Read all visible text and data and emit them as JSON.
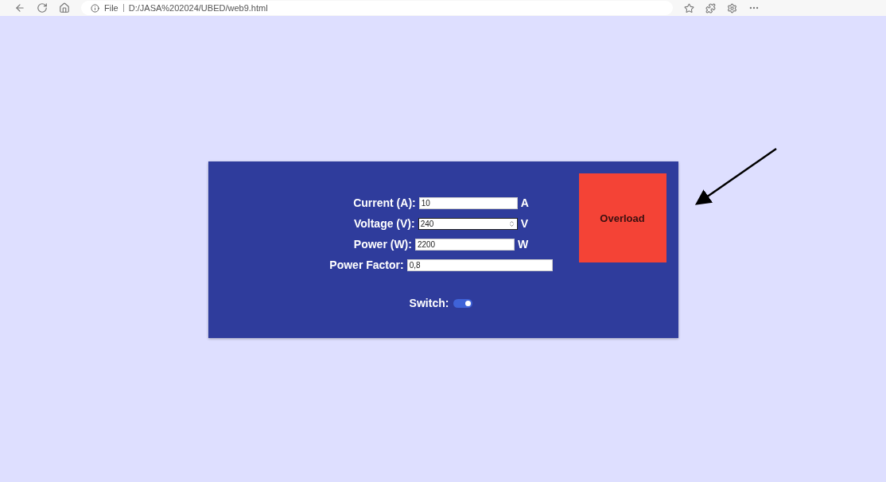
{
  "browser": {
    "site_label": "File",
    "address": "D:/JASA%202024/UBED/web9.html"
  },
  "fields": [
    {
      "label": "Current (A):",
      "value": "10",
      "unit": "A",
      "kind": "text"
    },
    {
      "label": "Voltage (V):",
      "value": "240",
      "unit": "V",
      "kind": "number"
    },
    {
      "label": "Power (W):",
      "value": "2200",
      "unit": "W",
      "kind": "text"
    },
    {
      "label": "Power Factor:",
      "value": "0,8",
      "kind": "text"
    }
  ],
  "switch": {
    "label": "Switch:",
    "on": true
  },
  "status": {
    "text": "Overload",
    "color": "#f44336"
  }
}
